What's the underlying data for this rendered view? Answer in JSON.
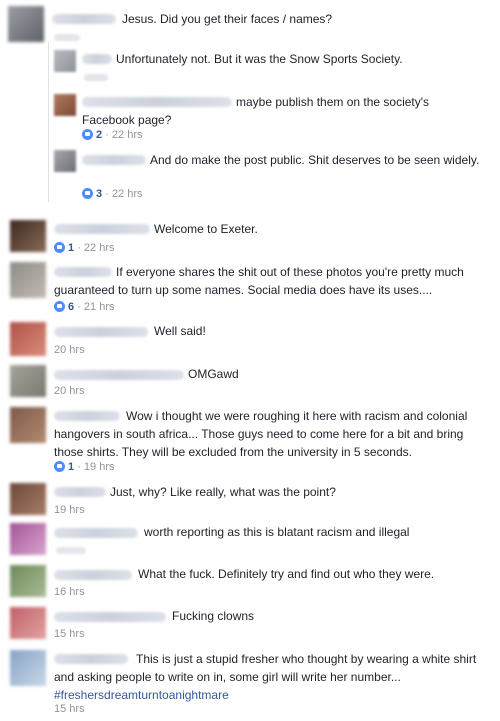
{
  "colors": {
    "link": "#365899",
    "meta": "#90949c",
    "like": "#4c8ef7",
    "text": "#1d2129"
  },
  "comments": [
    {
      "text": "Jesus. Did you get their faces / names?",
      "time": ""
    },
    {
      "text": "Unfortunately not. But it was the Snow Sports Society.",
      "time": ""
    },
    {
      "text": "maybe publish them on the society's Facebook page?",
      "likes": "2",
      "time": "· 22 hrs"
    },
    {
      "text": "And do make the post public. Shit deserves to be seen widely.",
      "likes": "3",
      "time": "· 22 hrs"
    },
    {
      "text": "Welcome to Exeter.",
      "likes": "1",
      "time": "· 22 hrs"
    },
    {
      "text": "If everyone shares the shit out of these photos you're pretty much guaranteed to turn up some names. Social media does have its uses....",
      "likes": "6",
      "time": "· 21 hrs"
    },
    {
      "text": "Well said!",
      "time": "20 hrs"
    },
    {
      "text": "OMGawd",
      "time": "20 hrs"
    },
    {
      "text": "Wow i thought we were roughing it here with racism and colonial hangovers in south africa... Those guys need to come here for a bit and bring those shirts. They will be excluded from the university in 5 seconds.",
      "likes": "1",
      "time": "· 19 hrs"
    },
    {
      "text": "Just, why? Like really, what was the point?",
      "time": "19 hrs"
    },
    {
      "text": "worth reporting as this is blatant racism and illegal",
      "time": ""
    },
    {
      "text": "What the fuck. Definitely try and find out who they were.",
      "time": "16 hrs"
    },
    {
      "text": "Fucking clowns",
      "time": "15 hrs"
    },
    {
      "text": "This is just a stupid fresher who thought by wearing a white shirt and asking people to write on in, some girl will write her number...",
      "hashtag": "#freshersdreamturntoanightmare",
      "time": "15 hrs"
    }
  ]
}
